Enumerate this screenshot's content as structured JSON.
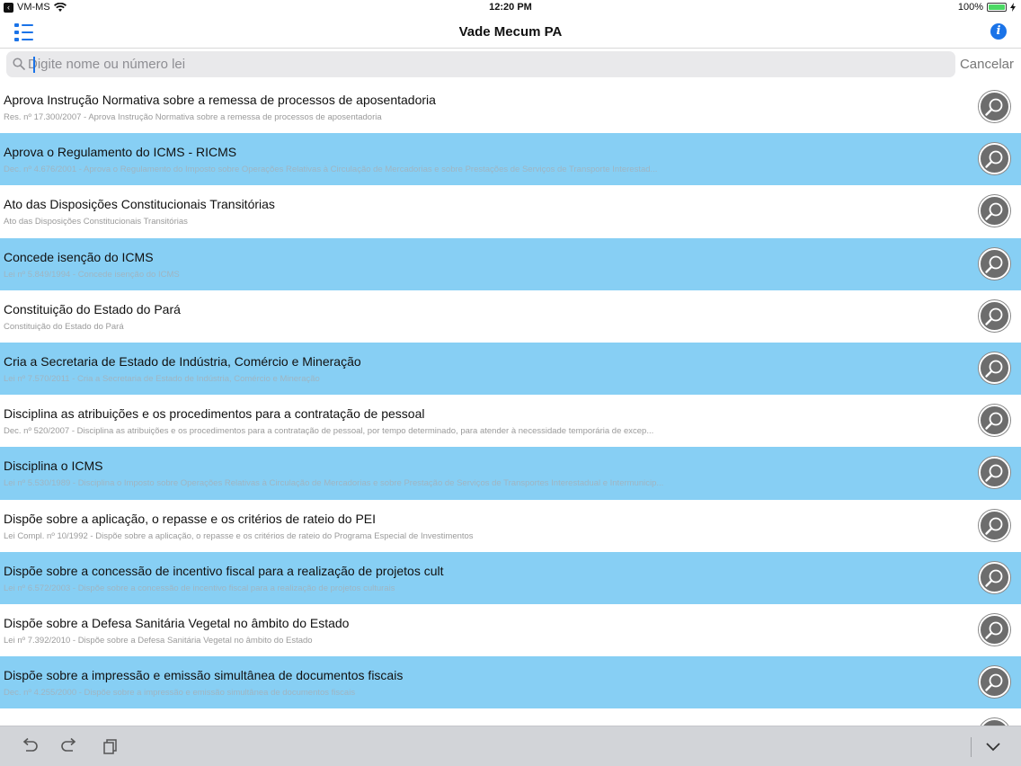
{
  "status_bar": {
    "carrier": "VM-MS",
    "time": "12:20 PM",
    "battery_percent": "100%",
    "battery_level": 1.0,
    "icons": [
      "back-to-app-icon",
      "wifi-icon",
      "battery-icon",
      "charging-bolt-icon"
    ]
  },
  "nav": {
    "title": "Vade Mecum PA",
    "left_icon": "list-menu-icon",
    "right_icon": "info-icon",
    "accent_color": "#1a73e8"
  },
  "search": {
    "placeholder": "Digite nome ou número lei",
    "value": "",
    "cancel_label": "Cancelar"
  },
  "list": {
    "highlight_color": "#87cff4",
    "items": [
      {
        "title": "Aprova Instrução Normativa sobre a remessa de processos de aposentadoria",
        "subtitle": "Res. nº 17.300/2007 - Aprova Instrução Normativa sobre a remessa de processos de aposentadoria",
        "highlighted": false
      },
      {
        "title": "Aprova o Regulamento do ICMS - RICMS",
        "subtitle": "Dec. nº 4.676/2001 - Aprova o Regulamento do Imposto sobre Operações Relativas à Circulação de Mercadorias e sobre Prestações de Serviços de Transporte Interestad...",
        "highlighted": true
      },
      {
        "title": "Ato das Disposições Constitucionais Transitórias",
        "subtitle": "Ato das Disposições Constitucionais Transitórias",
        "highlighted": false
      },
      {
        "title": "Concede isenção do ICMS",
        "subtitle": "Lei nº 5.849/1994 - Concede isenção do ICMS",
        "highlighted": true
      },
      {
        "title": "Constituição do Estado do Pará",
        "subtitle": "Constituição do Estado do Pará",
        "highlighted": false
      },
      {
        "title": "Cria a Secretaria de Estado de Indústria, Comércio  e Mineração",
        "subtitle": "Lei nº 7.570/2011 - Cria a Secretaria de Estado de Indústria, Comércio  e Mineração",
        "highlighted": true
      },
      {
        "title": "Disciplina as atribuições e os procedimentos para a contratação de pessoal",
        "subtitle": "Dec. nº 520/2007 - Disciplina as atribuições e os procedimentos para a contratação de pessoal, por tempo determinado, para atender à necessidade temporária de excep...",
        "highlighted": false
      },
      {
        "title": "Disciplina o ICMS",
        "subtitle": "Lei nº 5.530/1989 - Disciplina o Imposto sobre Operações Relativas à Circulação de Mercadorias e sobre Prestação de Serviços de Transportes Interestadual e Intermunicip...",
        "highlighted": true
      },
      {
        "title": "Dispõe sobre a aplicação, o repasse e os critérios de rateio do PEI",
        "subtitle": "Lei Compl. nº 10/1992 - Dispõe sobre a aplicação, o repasse e os critérios de rateio do Programa Especial de Investimentos",
        "highlighted": false
      },
      {
        "title": "Dispõe sobre a concessão de incentivo fiscal para a realização de projetos cult",
        "subtitle": "Lei nº 6.572/2003 - Dispõe sobre a concessão de incentivo fiscal para a realização de projetos culturais",
        "highlighted": true
      },
      {
        "title": "Dispõe sobre a Defesa Sanitária Vegetal no âmbito do Estado",
        "subtitle": "Lei nº 7.392/2010 - Dispõe sobre a Defesa Sanitária Vegetal no âmbito do Estado",
        "highlighted": false
      },
      {
        "title": "Dispõe sobre a impressão e emissão simultânea de documentos fiscais",
        "subtitle": "Dec. nº 4.255/2000 - Dispõe sobre a impressão e emissão simultânea de documentos fiscais",
        "highlighted": true
      },
      {
        "title": "",
        "subtitle": "",
        "highlighted": false
      }
    ],
    "row_button_icon": "magnifier-icon"
  },
  "toolbar": {
    "icons": [
      "undo-icon",
      "redo-icon",
      "paste-icon",
      "chevron-down-icon"
    ]
  }
}
